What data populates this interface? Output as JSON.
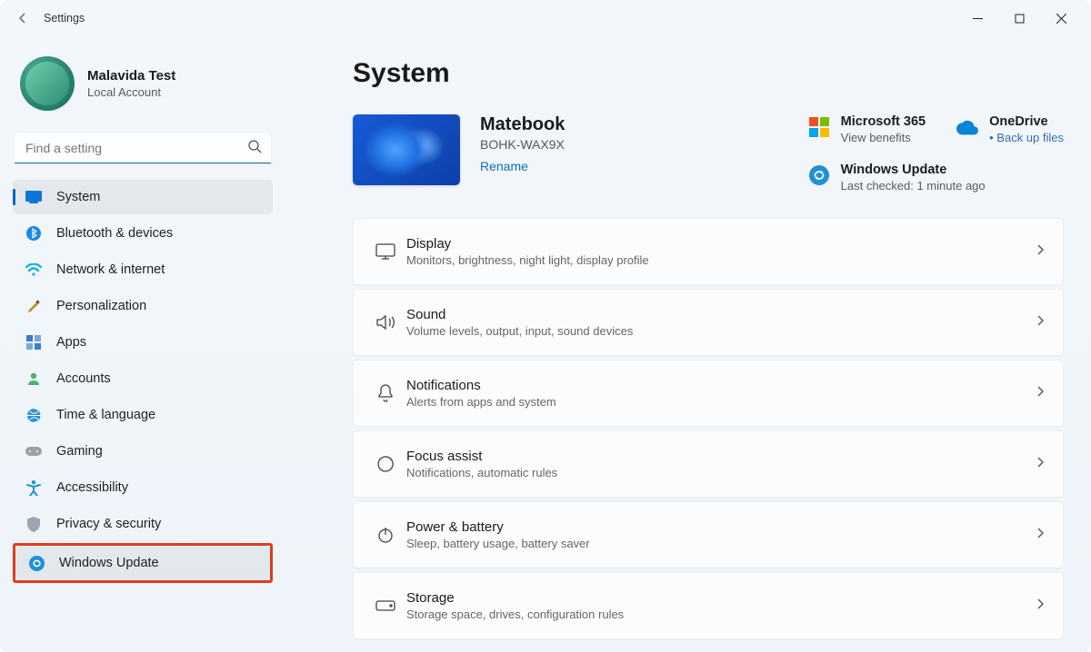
{
  "window": {
    "title": "Settings"
  },
  "profile": {
    "name": "Malavida Test",
    "sub": "Local Account"
  },
  "search": {
    "placeholder": "Find a setting"
  },
  "sidebar": {
    "items": [
      {
        "label": "System"
      },
      {
        "label": "Bluetooth & devices"
      },
      {
        "label": "Network & internet"
      },
      {
        "label": "Personalization"
      },
      {
        "label": "Apps"
      },
      {
        "label": "Accounts"
      },
      {
        "label": "Time & language"
      },
      {
        "label": "Gaming"
      },
      {
        "label": "Accessibility"
      },
      {
        "label": "Privacy & security"
      },
      {
        "label": "Windows Update"
      }
    ]
  },
  "page": {
    "title": "System"
  },
  "device": {
    "name": "Matebook",
    "model": "BOHK-WAX9X",
    "rename": "Rename"
  },
  "promos": {
    "m365": {
      "title": "Microsoft 365",
      "sub": "View benefits"
    },
    "onedrive": {
      "title": "OneDrive",
      "sub": "Back up files"
    },
    "update": {
      "title": "Windows Update",
      "sub": "Last checked: 1 minute ago"
    }
  },
  "settings": [
    {
      "title": "Display",
      "sub": "Monitors, brightness, night light, display profile"
    },
    {
      "title": "Sound",
      "sub": "Volume levels, output, input, sound devices"
    },
    {
      "title": "Notifications",
      "sub": "Alerts from apps and system"
    },
    {
      "title": "Focus assist",
      "sub": "Notifications, automatic rules"
    },
    {
      "title": "Power & battery",
      "sub": "Sleep, battery usage, battery saver"
    },
    {
      "title": "Storage",
      "sub": "Storage space, drives, configuration rules"
    }
  ]
}
